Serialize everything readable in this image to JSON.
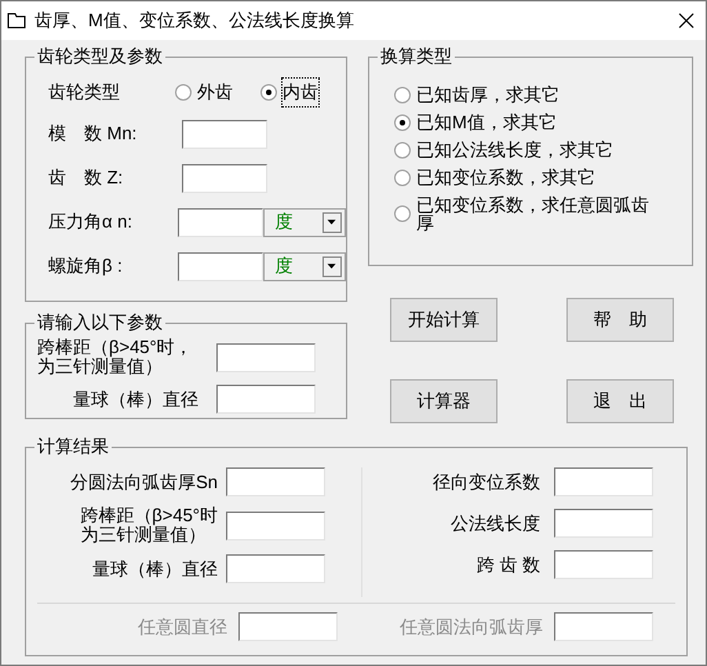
{
  "window": {
    "title": "齿厚、M值、变位系数、公法线长度换算"
  },
  "gear_params": {
    "title": "齿轮类型及参数",
    "gear_type": {
      "label": "齿轮类型",
      "options": [
        {
          "label": "外齿",
          "selected": false
        },
        {
          "label": "内齿",
          "selected": true
        }
      ]
    },
    "fields": [
      {
        "kind": "text",
        "label": "模　数 Mn:"
      },
      {
        "kind": "text",
        "label": "齿　数 Z:"
      },
      {
        "kind": "unit",
        "label": "压力角α n:",
        "unit": "度"
      },
      {
        "kind": "unit",
        "label": "螺旋角β :",
        "unit": "度"
      }
    ]
  },
  "conversion_type": {
    "title": "换算类型",
    "options": [
      {
        "label": "已知齿厚，求其它",
        "selected": false
      },
      {
        "label": "已知M值，求其它",
        "selected": true
      },
      {
        "label": "已知公法线长度，求其它",
        "selected": false
      },
      {
        "label": "已知变位系数，求其它",
        "selected": false
      },
      {
        "label": "已知变位系数，求任意圆弧齿厚",
        "selected": false
      }
    ]
  },
  "input_params": {
    "title": "请输入以下参数",
    "fields": [
      {
        "lines": [
          "跨棒距（β>45°时，",
          "为三针测量值）"
        ]
      },
      {
        "lines": [
          "量球（棒）直径"
        ]
      }
    ]
  },
  "buttons": [
    "开始计算",
    "帮　助",
    "计算器",
    "退　出"
  ],
  "results": {
    "title": "计算结果",
    "left": [
      {
        "lines": [
          "分圆法向弧齿厚Sn"
        ]
      },
      {
        "lines": [
          "跨棒距（β>45°时",
          "为三针测量值）"
        ]
      },
      {
        "lines": [
          "量球（棒）直径"
        ]
      }
    ],
    "right": [
      {
        "lines": [
          "径向变位系数"
        ]
      },
      {
        "lines": [
          "公法线长度"
        ]
      },
      {
        "lines": [
          "跨 齿 数"
        ]
      }
    ],
    "bottom": [
      {
        "label": "任意圆直径",
        "disabled": true
      },
      {
        "label": "任意圆法向弧齿厚",
        "disabled": true
      }
    ]
  }
}
